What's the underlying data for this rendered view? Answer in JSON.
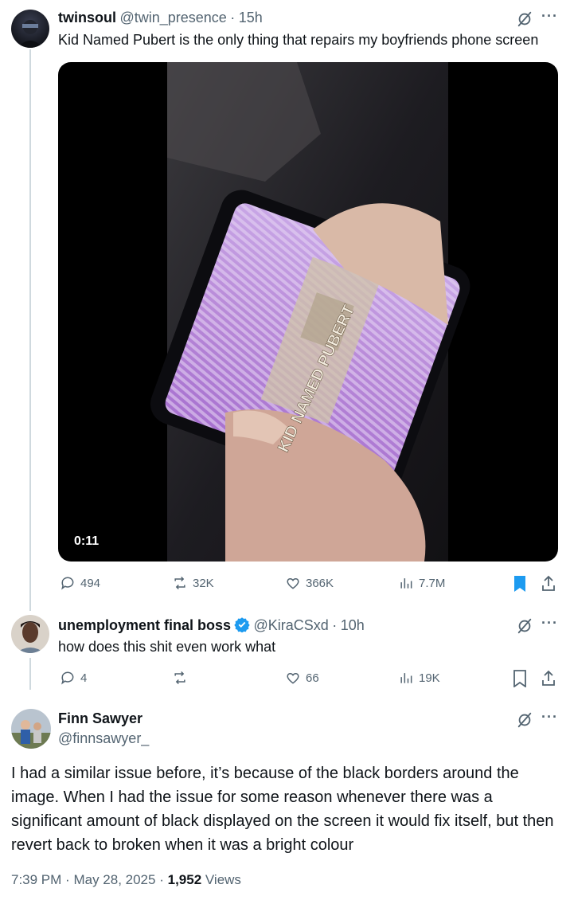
{
  "tweet1": {
    "name": "twinsoul",
    "handle": "@twin_presence",
    "time": "15h",
    "text": "Kid Named Pubert is the only thing that repairs my boyfriends phone screen",
    "video_duration": "0:11",
    "video_overlay_text": "KID NAMED PUBERT",
    "replies": "494",
    "reposts": "32K",
    "likes": "366K",
    "views": "7.7M"
  },
  "tweet2": {
    "name": "unemployment final boss",
    "handle": "@KiraCSxd",
    "time": "10h",
    "text": "how does this shit even work what",
    "replies": "4",
    "reposts": "",
    "likes": "66",
    "views": "19K"
  },
  "tweet3": {
    "name": "Finn Sawyer",
    "handle": "@finnsawyer_",
    "body": "I had a similar issue before, it’s because of the black borders around the image. When I had the issue for some reason whenever there was a significant amount of black displayed on the screen it would fix itself, but then revert back to broken when it was a bright colour",
    "time": "7:39 PM",
    "date": "May 28, 2025",
    "views_count": "1,952",
    "views_label": "Views"
  },
  "separator": "·",
  "colors": {
    "accent": "#1d9bf0",
    "muted": "#536471",
    "text": "#0f1419",
    "thread_line": "#cfd9de"
  }
}
